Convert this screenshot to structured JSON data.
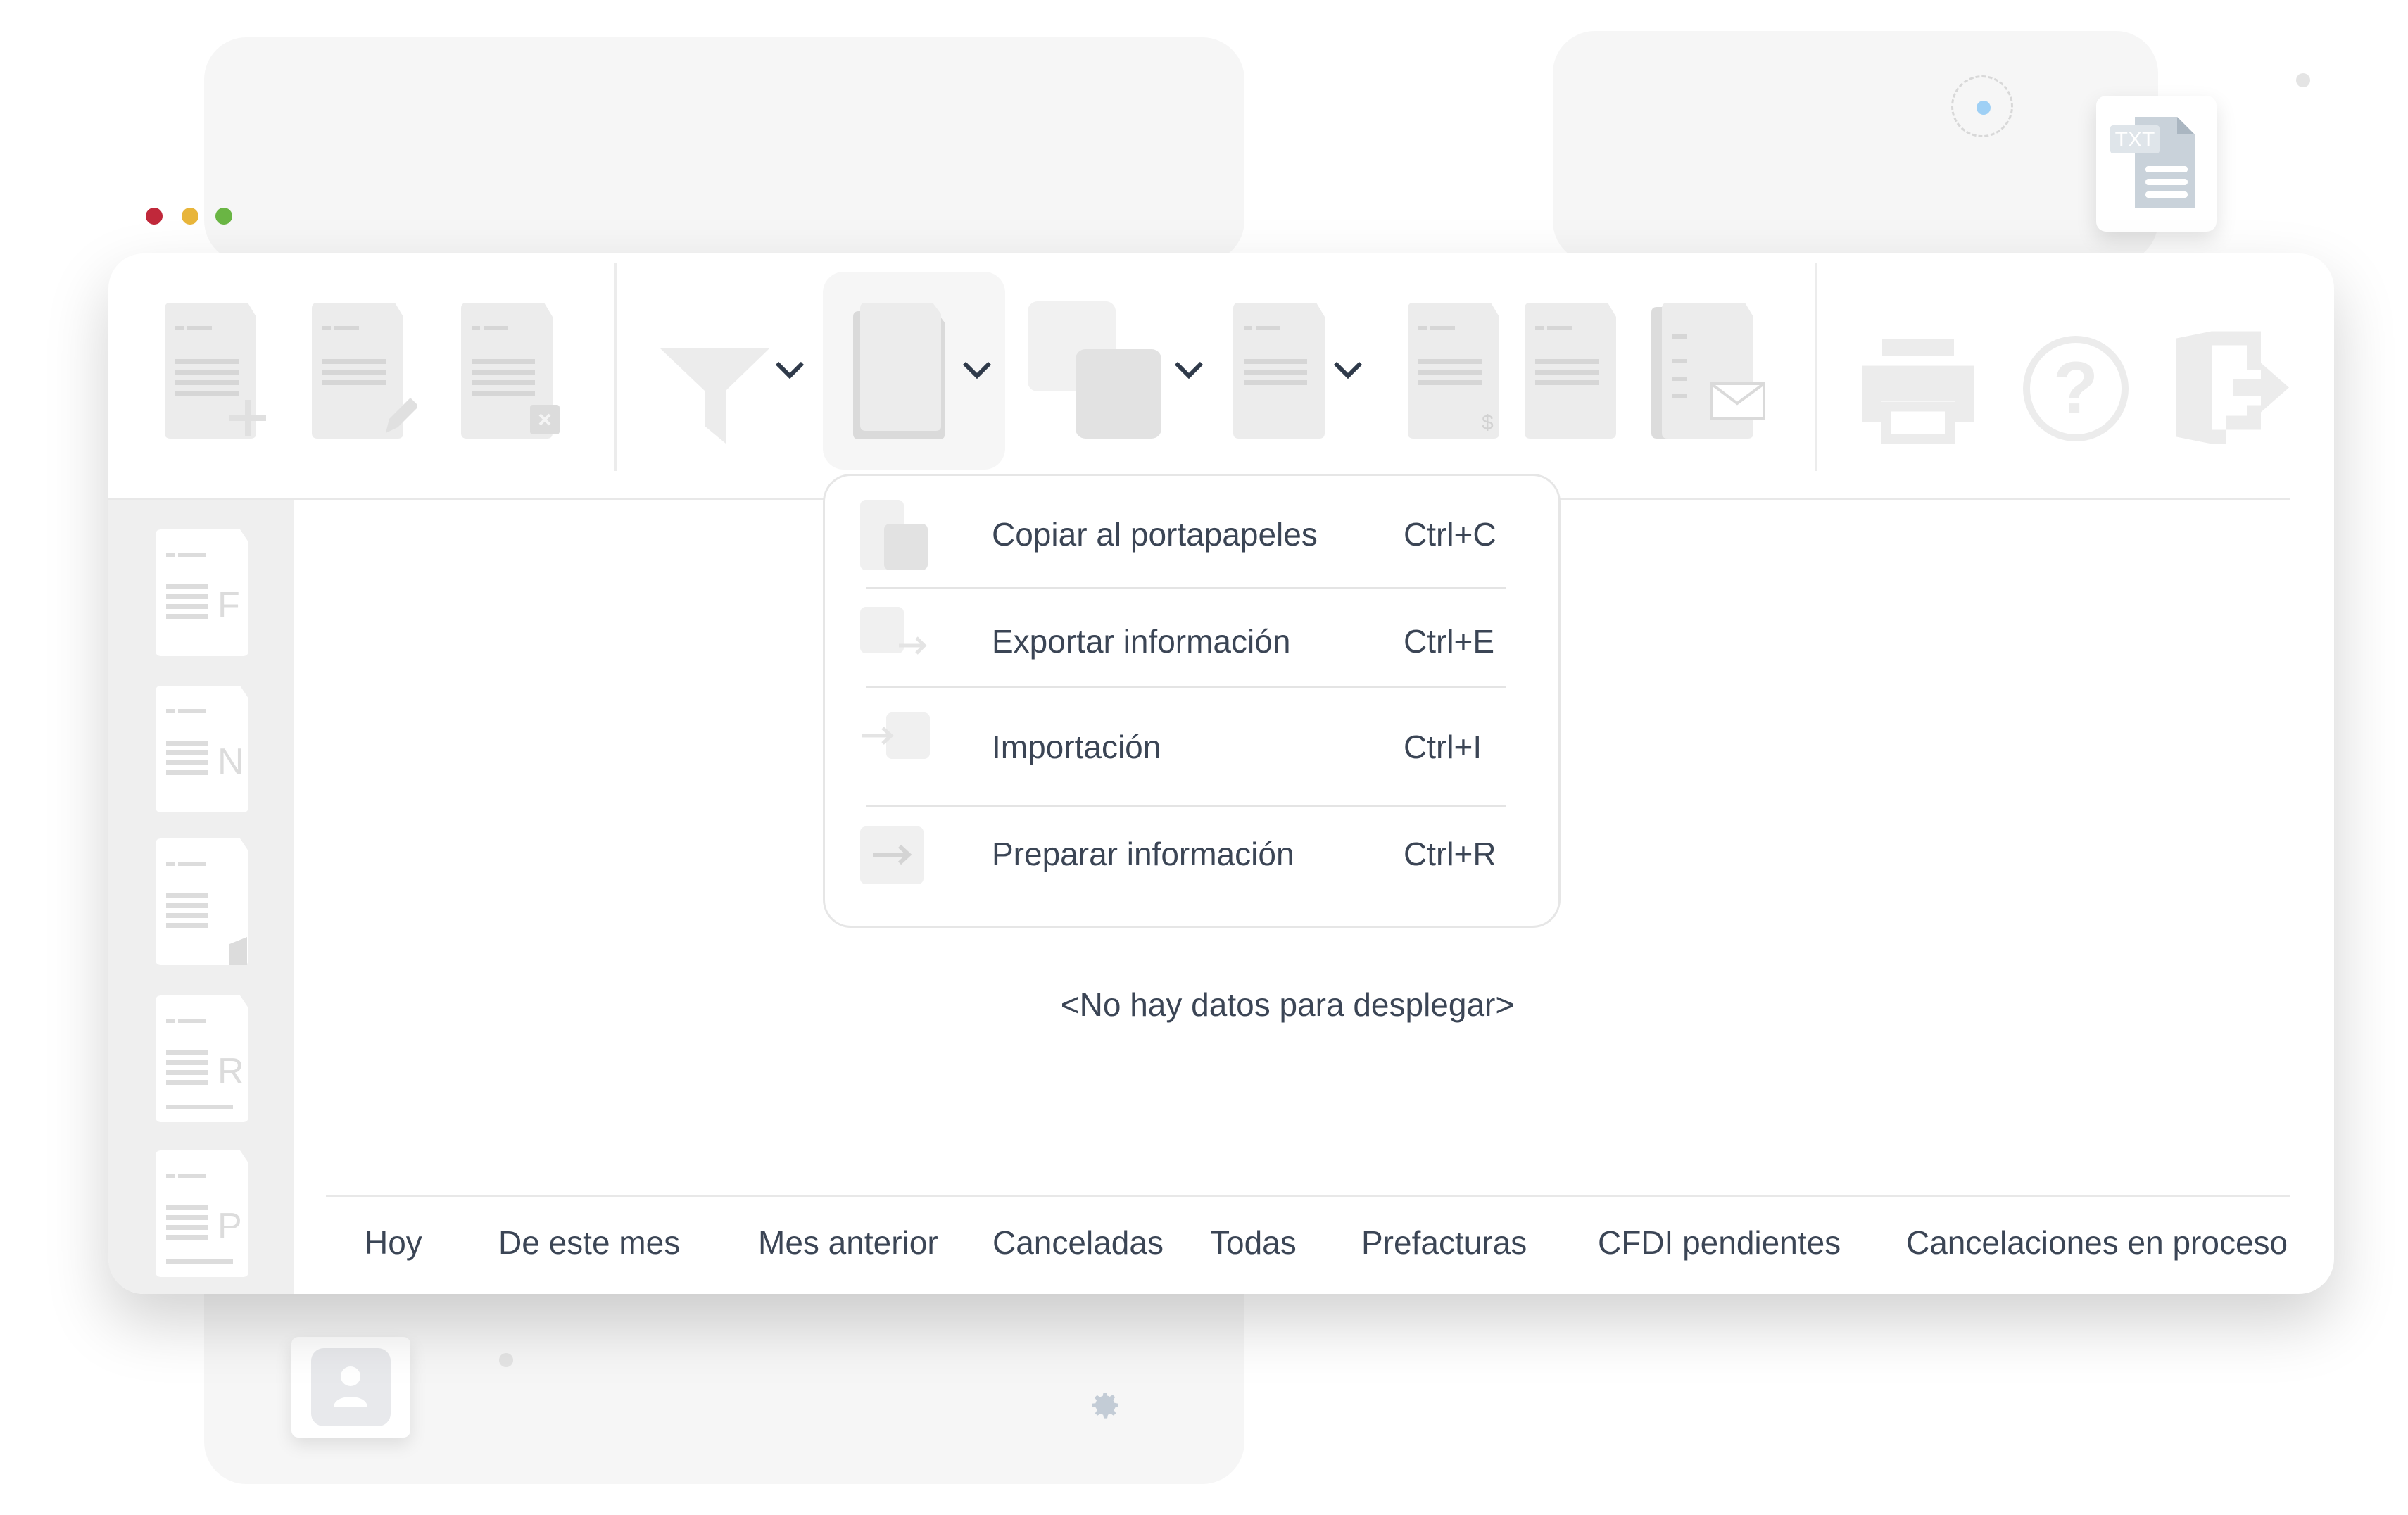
{
  "window": {
    "traffic_lights": [
      "#c0283a",
      "#e8b53a",
      "#6ab544"
    ]
  },
  "toolbar": {
    "buttons": [
      {
        "name": "new-document",
        "icon": "document-plus-icon"
      },
      {
        "name": "edit-document",
        "icon": "document-pencil-icon"
      },
      {
        "name": "cancel-document",
        "icon": "document-x-icon"
      },
      {
        "name": "filter",
        "icon": "filter-icon",
        "dropdown": true
      },
      {
        "name": "copy",
        "icon": "copy-icon",
        "dropdown": true,
        "active": true
      },
      {
        "name": "duplicate",
        "icon": "squares-icon",
        "dropdown": true
      },
      {
        "name": "document-options",
        "icon": "document-icon",
        "dropdown": true
      },
      {
        "name": "payment-document",
        "icon": "document-dollar-icon"
      },
      {
        "name": "document",
        "icon": "document-icon"
      },
      {
        "name": "email-document",
        "icon": "document-mail-icon"
      },
      {
        "name": "print",
        "icon": "printer-icon"
      },
      {
        "name": "help",
        "icon": "help-icon"
      },
      {
        "name": "exit",
        "icon": "exit-icon"
      }
    ]
  },
  "menu": {
    "items": [
      {
        "label": "Copiar al portapapeles",
        "shortcut": "Ctrl+C",
        "icon": "copy-icon"
      },
      {
        "label": "Exportar información",
        "shortcut": "Ctrl+E",
        "icon": "export-icon"
      },
      {
        "label": "Importación",
        "shortcut": "Ctrl+I",
        "icon": "import-icon"
      },
      {
        "label": "Preparar información",
        "shortcut": "Ctrl+R",
        "icon": "prepare-icon"
      }
    ]
  },
  "sidebar": {
    "items": [
      {
        "letter": "F"
      },
      {
        "letter": "N"
      },
      {
        "letter": ""
      },
      {
        "letter": "R"
      },
      {
        "letter": "P"
      }
    ]
  },
  "main": {
    "empty_message": "<No hay datos para desplegar>"
  },
  "tabs": [
    {
      "label": "Hoy"
    },
    {
      "label": "De este mes"
    },
    {
      "label": "Mes anterior"
    },
    {
      "label": "Canceladas"
    },
    {
      "label": "Todas"
    },
    {
      "label": "Prefacturas"
    },
    {
      "label": "CFDI pendientes"
    },
    {
      "label": "Cancelaciones en proceso"
    }
  ],
  "decor": {
    "file_badge": "TXT"
  },
  "colors": {
    "text": "#3b4555",
    "icon_gray": "#ececec",
    "accent_dot": "#9fd0f5"
  }
}
